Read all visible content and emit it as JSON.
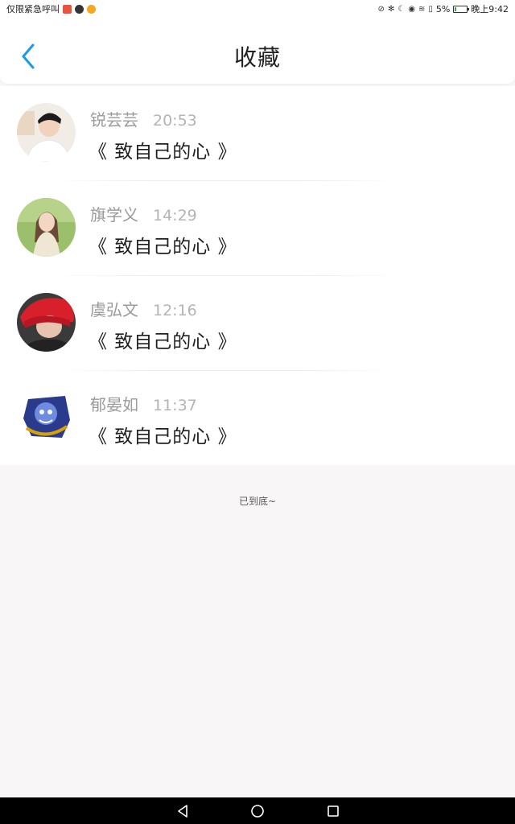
{
  "status_bar": {
    "left_text": "仅限紧急呼叫",
    "battery": "5%",
    "time": "晚上9:42"
  },
  "header": {
    "title": "收藏",
    "back_icon": "chevron-left-icon",
    "accent_color": "#1a9be8"
  },
  "favorites": [
    {
      "name": "锐芸芸",
      "time": "20:53",
      "title": "《 致自己的心 》"
    },
    {
      "name": "旗学义",
      "time": "14:29",
      "title": "《 致自己的心 》"
    },
    {
      "name": "虞弘文",
      "time": "12:16",
      "title": "《 致自己的心 》"
    },
    {
      "name": "郁晏如",
      "time": "11:37",
      "title": "《 致自己的心 》"
    }
  ],
  "footer": {
    "end_text": "已到底~"
  },
  "nav_bar": {
    "icons": [
      "back-triangle-icon",
      "home-circle-icon",
      "recents-square-icon"
    ]
  }
}
